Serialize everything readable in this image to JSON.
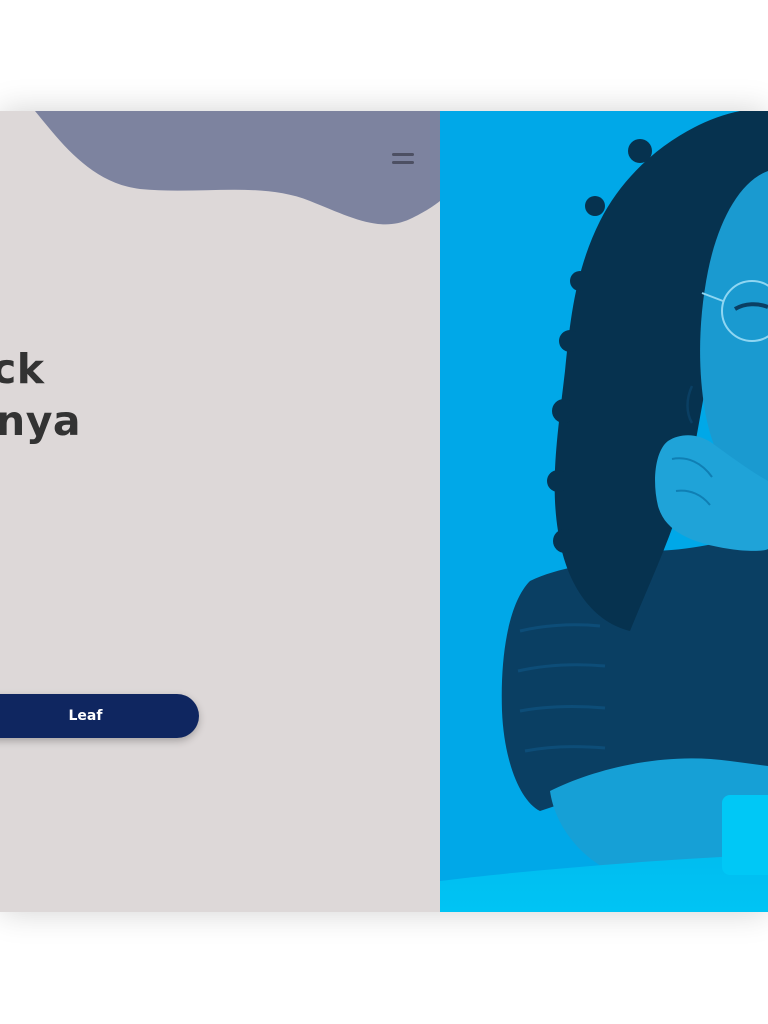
{
  "hero": {
    "headline_line1": "ck",
    "headline_line2": "nya",
    "cta_label": "Leaf"
  },
  "header": {
    "menu_icon": "hamburger-menu-icon"
  },
  "photo": {
    "icon": "portrait-photo"
  },
  "colors": {
    "left_background": "#ddd8d8",
    "blob": "#7d839f",
    "cta_background": "#0f2660",
    "cta_text": "#ffffff",
    "photo_tint": "#00a8e8",
    "headline_text": "#333333"
  }
}
